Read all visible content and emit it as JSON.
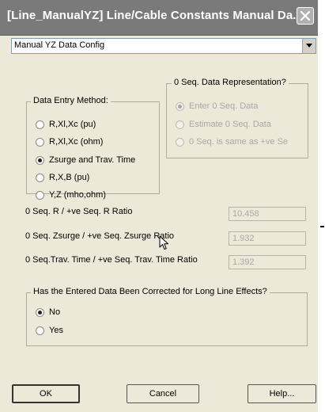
{
  "window": {
    "title": "[Line_ManualYZ] Line/Cable Constants Manual Da..."
  },
  "config_combo": {
    "selected": "Manual YZ Data Config"
  },
  "data_entry": {
    "title": "Data Entry Method:",
    "options": [
      {
        "label": "R,Xl,Xc (pu)",
        "checked": false
      },
      {
        "label": "R,Xl,Xc (ohm)",
        "checked": false
      },
      {
        "label": "Zsurge and Trav. Time",
        "checked": true
      },
      {
        "label": "R,X,B (pu)",
        "checked": false
      },
      {
        "label": "Y,Z (mho,ohm)",
        "checked": false
      }
    ]
  },
  "zero_seq": {
    "title": "0 Seq. Data Representation?",
    "options": [
      {
        "label": "Enter 0 Seq. Data",
        "checked": true
      },
      {
        "label": "Estimate 0 Seq. Data",
        "checked": false
      },
      {
        "label": "0 Seq. is same as +ve Se",
        "checked": false
      }
    ]
  },
  "ratios": [
    {
      "label": "0 Seq. R / +ve Seq. R Ratio",
      "value": "10.458"
    },
    {
      "label": "0 Seq. Zsurge / +ve Seq. Zsurge Ratio",
      "value": "1.932"
    },
    {
      "label": "0 Seq.Trav. Time / +ve Seq. Trav. Time Ratio",
      "value": "1.392"
    }
  ],
  "long_line": {
    "title": "Has the Entered Data Been Corrected for Long Line Effects?",
    "options": [
      {
        "label": "No",
        "checked": true
      },
      {
        "label": "Yes",
        "checked": false
      }
    ]
  },
  "buttons": {
    "ok": "OK",
    "cancel": "Cancel",
    "help": "Help..."
  },
  "icons": {
    "close": "close-icon",
    "dropdown": "chevron-down-icon",
    "cursor": "mouse-pointer-icon"
  }
}
